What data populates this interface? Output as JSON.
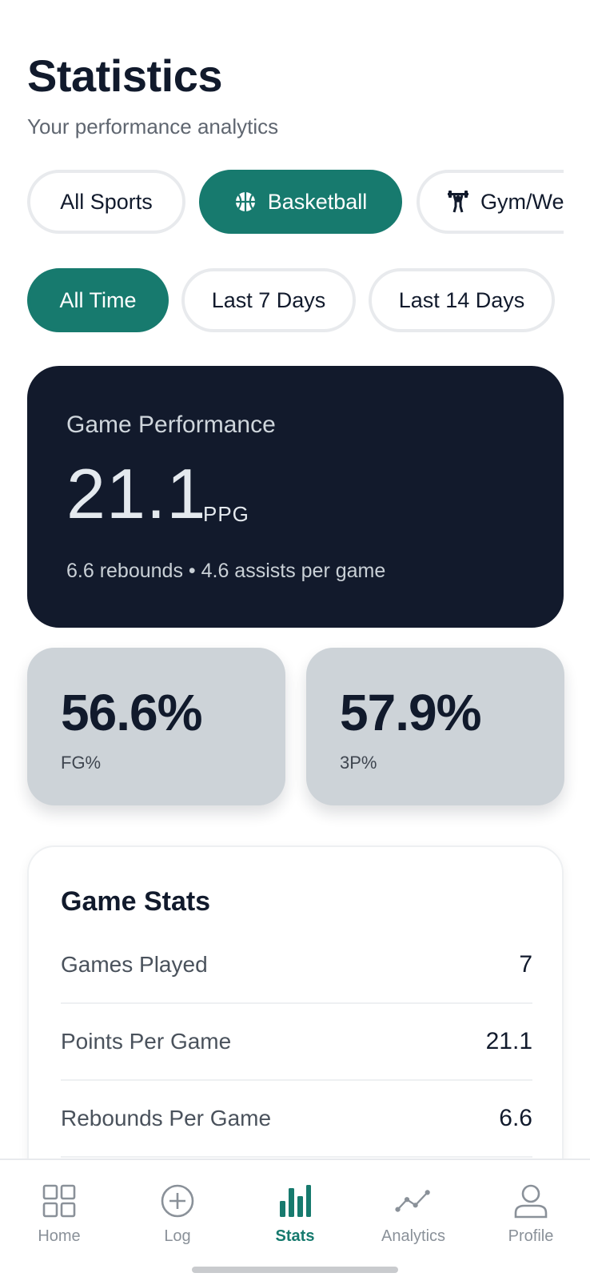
{
  "page": {
    "title": "Statistics",
    "subtitle": "Your performance analytics"
  },
  "sport_filters": [
    {
      "label": "All Sports",
      "icon": null,
      "active": false
    },
    {
      "label": "Basketball",
      "icon": "basketball-icon",
      "active": true
    },
    {
      "label": "Gym/We",
      "icon": "weightlifting-icon",
      "active": false
    }
  ],
  "period_filters": [
    {
      "label": "All Time",
      "active": true
    },
    {
      "label": "Last 7 Days",
      "active": false
    },
    {
      "label": "Last 14 Days",
      "active": false
    }
  ],
  "hero": {
    "label": "Game Performance",
    "value": "21.1",
    "unit": "PPG",
    "sub": "6.6 rebounds • 4.6 assists per game"
  },
  "stat_cards": [
    {
      "value": "56.6%",
      "label": "FG%"
    },
    {
      "value": "57.9%",
      "label": "3P%"
    }
  ],
  "game_stats": {
    "title": "Game Stats",
    "rows": [
      {
        "label": "Games Played",
        "value": "7"
      },
      {
        "label": "Points Per Game",
        "value": "21.1"
      },
      {
        "label": "Rebounds Per Game",
        "value": "6.6"
      }
    ]
  },
  "tabbar": [
    {
      "label": "Home",
      "icon": "grid-icon",
      "active": false
    },
    {
      "label": "Log",
      "icon": "plus-circle-icon",
      "active": false
    },
    {
      "label": "Stats",
      "icon": "bar-chart-icon",
      "active": true
    },
    {
      "label": "Analytics",
      "icon": "line-chart-icon",
      "active": false
    },
    {
      "label": "Profile",
      "icon": "person-icon",
      "active": false
    }
  ],
  "colors": {
    "accent": "#177a6e",
    "dark_card": "#121a2c",
    "stat_card": "#cdd3d8",
    "text": "#111a2c",
    "muted": "#8a9199"
  }
}
